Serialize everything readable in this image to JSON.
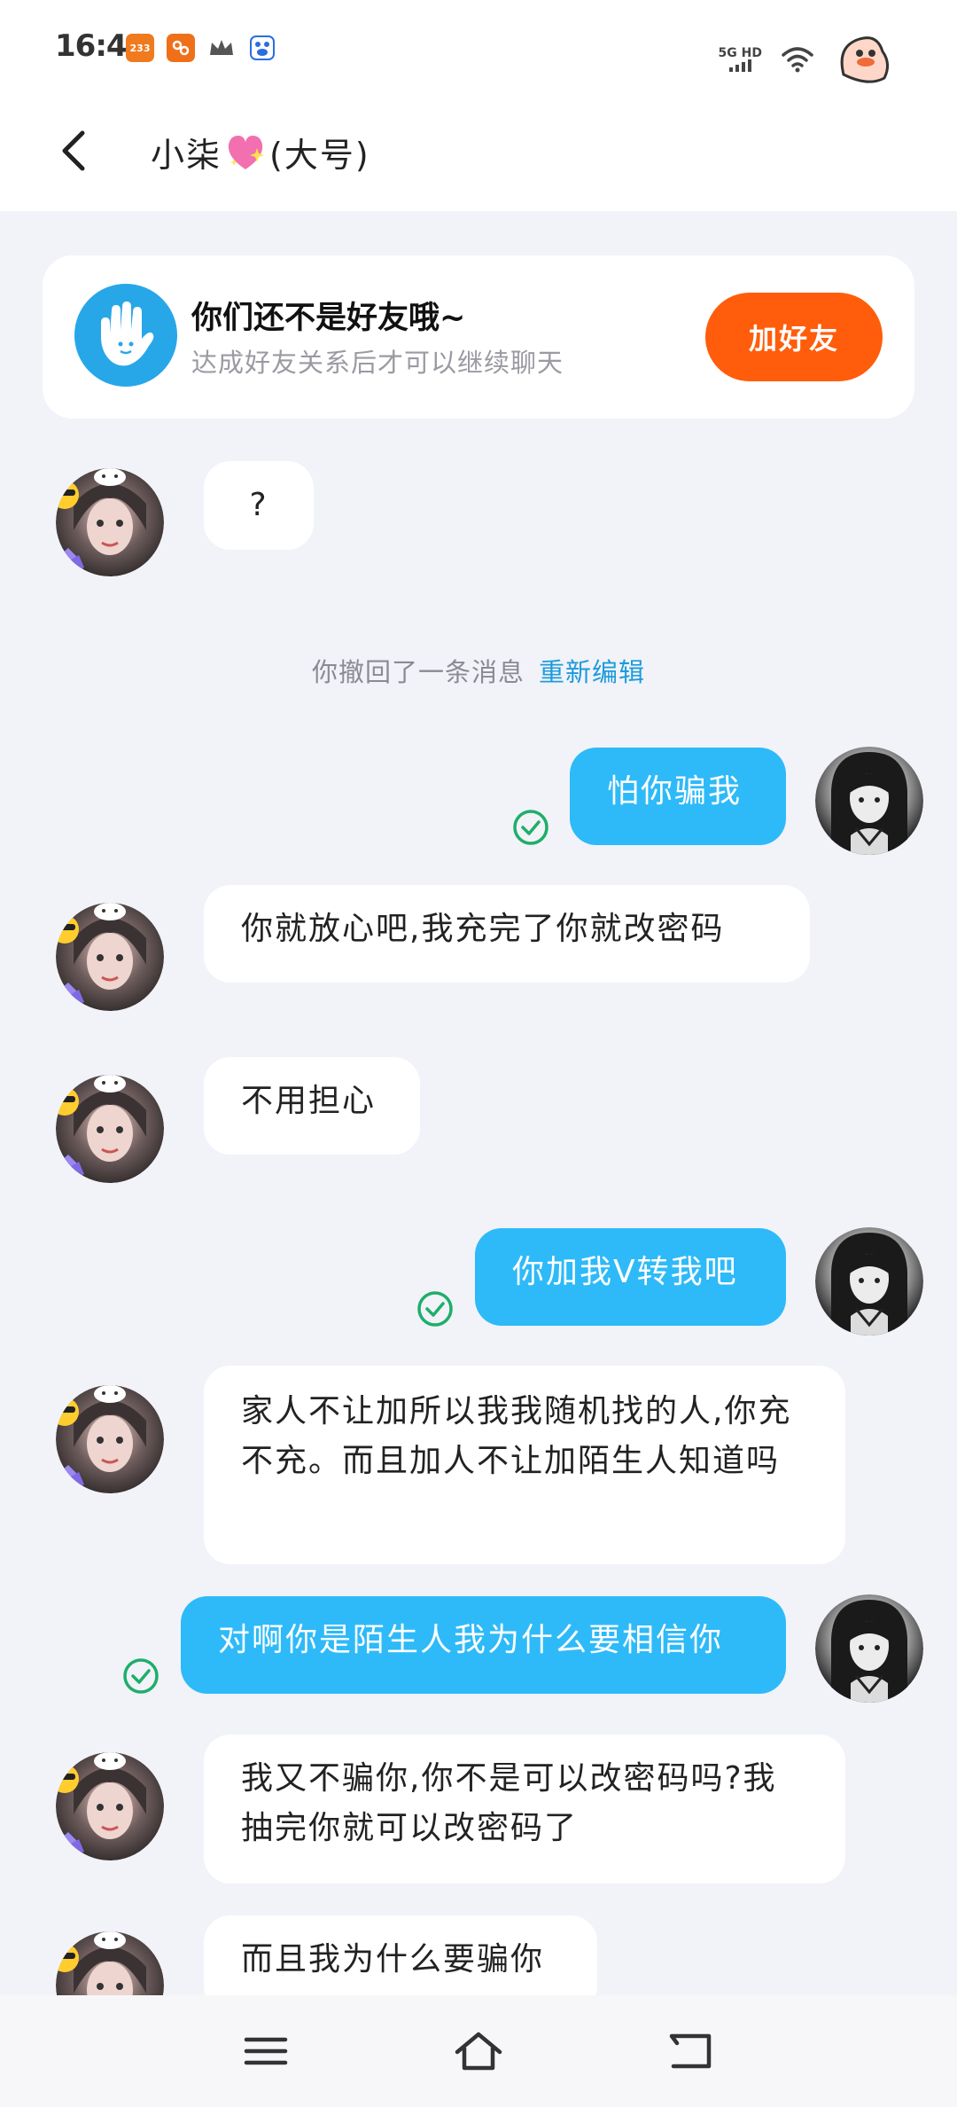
{
  "status_bar": {
    "time": "16:46",
    "badge_233": "233",
    "network": "5G HD",
    "icons": [
      "app-233-icon",
      "app-orange-icon",
      "crown-icon",
      "baidu-icon",
      "signal-icon",
      "wifi-icon",
      "duck-avatar-icon"
    ]
  },
  "header": {
    "title_prefix": "小柒",
    "title_suffix": "(大号)",
    "back_icon": "chevron-left-icon",
    "title_emoji": "sparkling-heart-icon"
  },
  "friend_card": {
    "title": "你们还不是好友哦~",
    "subtitle": "达成好友关系后才可以继续聊天",
    "button": "加好友",
    "icon": "hand-wave-icon"
  },
  "system": {
    "recalled": "你撤回了一条消息",
    "reedit": "重新编辑"
  },
  "messages": [
    {
      "from": "them",
      "text": "?"
    },
    {
      "from": "me",
      "text": "怕你骗我",
      "read": true
    },
    {
      "from": "them",
      "text": "你就放心吧,我充完了你就改密码"
    },
    {
      "from": "them",
      "text": "不用担心"
    },
    {
      "from": "me",
      "text": "你加我V转我吧",
      "read": true
    },
    {
      "from": "them",
      "text": "家人不让加所以我我随机找的人,你充不充。而且加人不让加陌生人知道吗"
    },
    {
      "from": "me",
      "text": "对啊你是陌生人我为什么要相信你",
      "read": true
    },
    {
      "from": "them",
      "text": "我又不骗你,你不是可以改密码吗?我抽完你就可以改密码了"
    },
    {
      "from": "them",
      "text": "而且我为什么要骗你"
    }
  ],
  "nav": [
    "menu-icon",
    "home-icon",
    "back-icon"
  ],
  "colors": {
    "accent_blue": "#2ebaf8",
    "add_friend_orange": "#ff5d0c",
    "read_tick_green": "#1fae6a",
    "background": "#f1f3f8"
  }
}
